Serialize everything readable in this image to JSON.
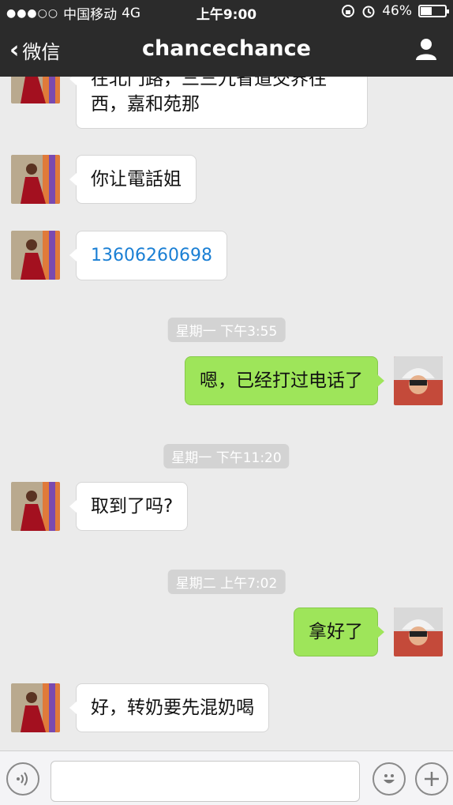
{
  "status_bar": {
    "signal": "●●●○○",
    "carrier": "中国移动",
    "network": "4G",
    "time": "上午9:00",
    "battery": "46%",
    "battery_level": 0.46
  },
  "nav": {
    "back_label": "微信",
    "title": "chancechance"
  },
  "messages": [
    {
      "side": "in",
      "text_line1": "在北门路，三三九省道交界往",
      "text_line2": "西，嘉和苑那"
    },
    {
      "side": "in",
      "text": "你让電話姐"
    },
    {
      "side": "in",
      "text": "13606260698",
      "is_phone": true
    },
    {
      "type": "time",
      "text": "星期一 下午3:55"
    },
    {
      "side": "out",
      "text": "嗯，已经打过电话了"
    },
    {
      "type": "time",
      "text": "星期一 下午11:20"
    },
    {
      "side": "in",
      "text": "取到了吗?"
    },
    {
      "type": "time",
      "text": "星期二 上午7:02"
    },
    {
      "side": "out",
      "text": "拿好了"
    },
    {
      "side": "in",
      "text": "好，转奶要先混奶喝"
    }
  ],
  "colors": {
    "bar": "#2b2b2b",
    "chat_bg": "#ebebeb",
    "out_bubble": "#9ee55a",
    "phone_link": "#1a7fd4"
  },
  "icons": {
    "voice": "voice-mode-icon",
    "emoji": "emoji-icon",
    "plus": "plus-icon",
    "profile": "person-icon"
  }
}
